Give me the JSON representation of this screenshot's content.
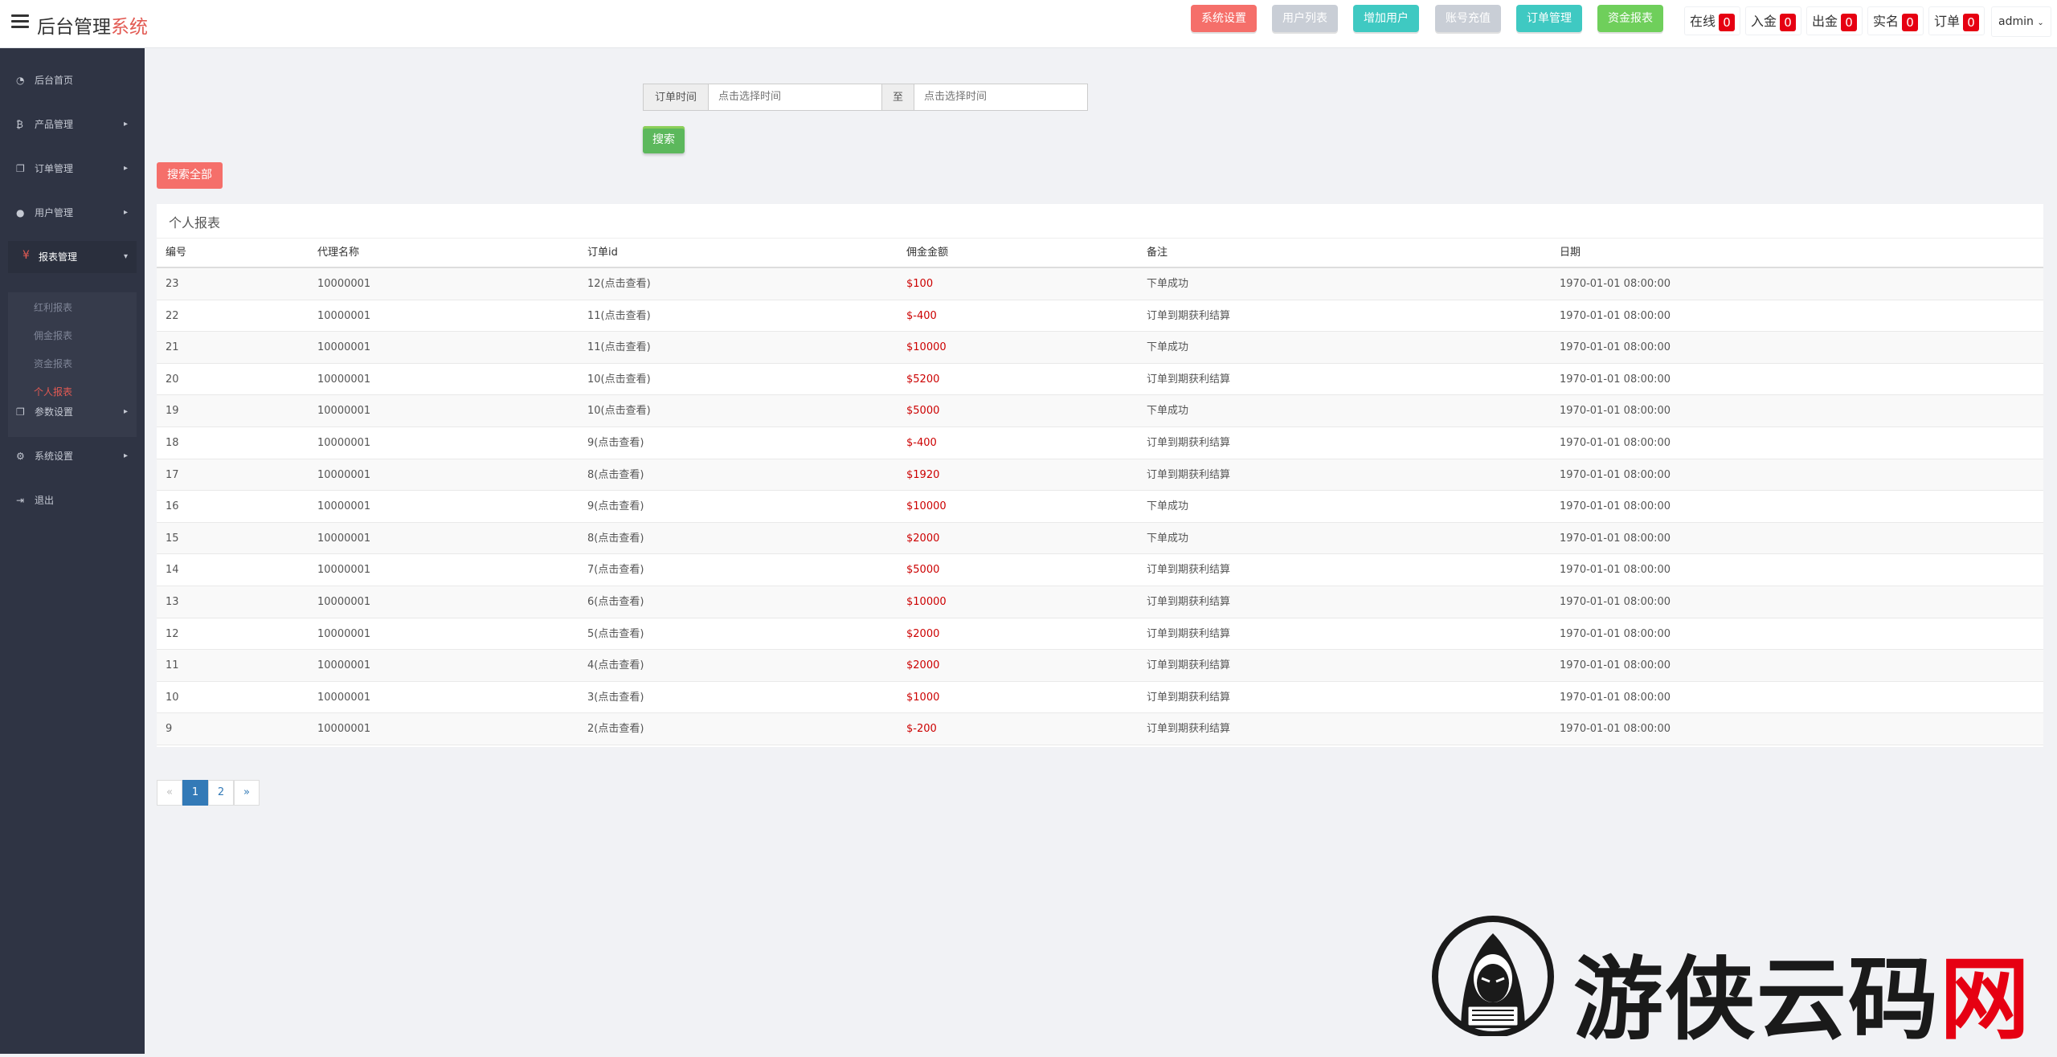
{
  "header": {
    "menu_icon": "hamburger-icon",
    "logo_main": "后台管理",
    "logo_accent": "系统",
    "buttons": [
      {
        "label": "系统设置",
        "color": "#f56f6a"
      },
      {
        "label": "用户列表",
        "color": "#c9ced6"
      },
      {
        "label": "增加用户",
        "color": "#3fc9c2"
      },
      {
        "label": "账号充值",
        "color": "#c9ced6"
      },
      {
        "label": "订单管理",
        "color": "#3fc9c2"
      },
      {
        "label": "资金报表",
        "color": "#6fcf5b"
      }
    ],
    "counters": [
      {
        "label": "在线",
        "count": "0"
      },
      {
        "label": "入金",
        "count": "0"
      },
      {
        "label": "出金",
        "count": "0"
      },
      {
        "label": "实名",
        "count": "0"
      },
      {
        "label": "订单",
        "count": "0"
      }
    ],
    "user": "admin"
  },
  "sidebar": {
    "items": [
      {
        "label": "后台首页",
        "icon": "dashboard-icon"
      },
      {
        "label": "产品管理",
        "icon": "bitcoin-icon"
      },
      {
        "label": "订单管理",
        "icon": "copy-icon"
      },
      {
        "label": "用户管理",
        "icon": "user-icon"
      },
      {
        "label": "报表管理",
        "icon": "yen-icon"
      },
      {
        "label": "参数设置",
        "icon": "copy-icon"
      },
      {
        "label": "系统设置",
        "icon": "gears-icon"
      },
      {
        "label": "退出",
        "icon": "sign-out-icon"
      }
    ],
    "report_submenu": [
      "红利报表",
      "佣金报表",
      "资金报表",
      "个人报表"
    ]
  },
  "filter": {
    "label": "订单时间",
    "start_placeholder": "点击选择时间",
    "separator": "至",
    "end_placeholder": "点击选择时间",
    "search_button": "搜索",
    "search_all_button": "搜索全部"
  },
  "panel": {
    "title": "个人报表",
    "columns": [
      "编号",
      "代理名称",
      "订单id",
      "佣金金额",
      "备注",
      "日期"
    ],
    "rows": [
      {
        "id": "23",
        "agent": "10000001",
        "order": "12(点击查看)",
        "amount": "$100",
        "note": "下单成功",
        "date": "1970-01-01 08:00:00"
      },
      {
        "id": "22",
        "agent": "10000001",
        "order": "11(点击查看)",
        "amount": "$-400",
        "note": "订单到期获利结算",
        "date": "1970-01-01 08:00:00"
      },
      {
        "id": "21",
        "agent": "10000001",
        "order": "11(点击查看)",
        "amount": "$10000",
        "note": "下单成功",
        "date": "1970-01-01 08:00:00"
      },
      {
        "id": "20",
        "agent": "10000001",
        "order": "10(点击查看)",
        "amount": "$5200",
        "note": "订单到期获利结算",
        "date": "1970-01-01 08:00:00"
      },
      {
        "id": "19",
        "agent": "10000001",
        "order": "10(点击查看)",
        "amount": "$5000",
        "note": "下单成功",
        "date": "1970-01-01 08:00:00"
      },
      {
        "id": "18",
        "agent": "10000001",
        "order": "9(点击查看)",
        "amount": "$-400",
        "note": "订单到期获利结算",
        "date": "1970-01-01 08:00:00"
      },
      {
        "id": "17",
        "agent": "10000001",
        "order": "8(点击查看)",
        "amount": "$1920",
        "note": "订单到期获利结算",
        "date": "1970-01-01 08:00:00"
      },
      {
        "id": "16",
        "agent": "10000001",
        "order": "9(点击查看)",
        "amount": "$10000",
        "note": "下单成功",
        "date": "1970-01-01 08:00:00"
      },
      {
        "id": "15",
        "agent": "10000001",
        "order": "8(点击查看)",
        "amount": "$2000",
        "note": "下单成功",
        "date": "1970-01-01 08:00:00"
      },
      {
        "id": "14",
        "agent": "10000001",
        "order": "7(点击查看)",
        "amount": "$5000",
        "note": "订单到期获利结算",
        "date": "1970-01-01 08:00:00"
      },
      {
        "id": "13",
        "agent": "10000001",
        "order": "6(点击查看)",
        "amount": "$10000",
        "note": "订单到期获利结算",
        "date": "1970-01-01 08:00:00"
      },
      {
        "id": "12",
        "agent": "10000001",
        "order": "5(点击查看)",
        "amount": "$2000",
        "note": "订单到期获利结算",
        "date": "1970-01-01 08:00:00"
      },
      {
        "id": "11",
        "agent": "10000001",
        "order": "4(点击查看)",
        "amount": "$2000",
        "note": "订单到期获利结算",
        "date": "1970-01-01 08:00:00"
      },
      {
        "id": "10",
        "agent": "10000001",
        "order": "3(点击查看)",
        "amount": "$1000",
        "note": "订单到期获利结算",
        "date": "1970-01-01 08:00:00"
      },
      {
        "id": "9",
        "agent": "10000001",
        "order": "2(点击查看)",
        "amount": "$-200",
        "note": "订单到期获利结算",
        "date": "1970-01-01 08:00:00"
      }
    ]
  },
  "pagination": {
    "prev": "«",
    "pages": [
      "1",
      "2"
    ],
    "next": "»",
    "current": "1"
  },
  "watermark": {
    "text_main": "游侠云码",
    "text_accent": "网"
  }
}
